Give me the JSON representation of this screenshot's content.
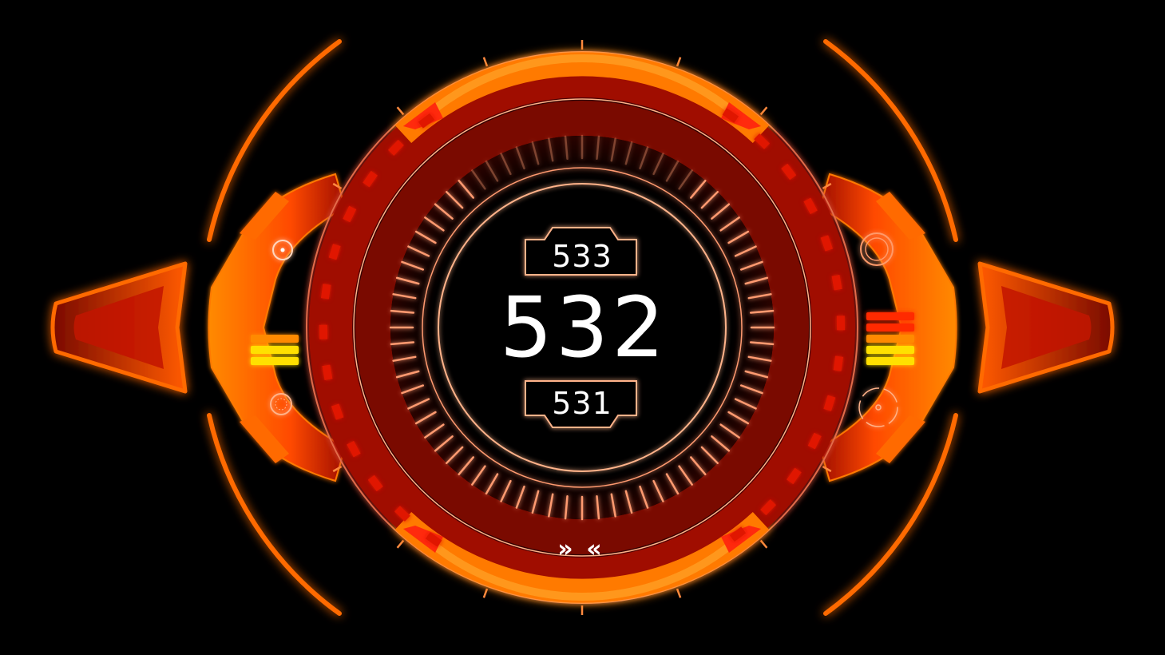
{
  "gauge": {
    "current_value": "532",
    "next_value": "533",
    "previous_value": "531"
  },
  "controls": {
    "forward_chevron": "»",
    "back_chevron": "«"
  },
  "colors": {
    "background": "#000000",
    "primary_orange": "#ff7a00",
    "hot_red": "#e01800",
    "dark_red": "#6a0800",
    "yellow": "#ffe000",
    "line": "#ffb38a",
    "text": "#ffffff"
  },
  "indicators": {
    "left_bars": [
      "orange",
      "yellow",
      "yellow"
    ],
    "right_bars": [
      "red",
      "red",
      "orange",
      "yellow",
      "yellow"
    ]
  }
}
